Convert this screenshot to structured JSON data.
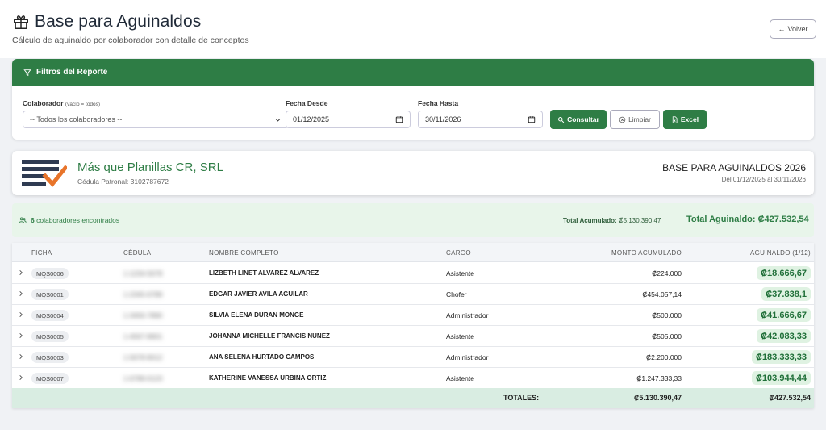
{
  "header": {
    "title": "Base para Aguinaldos",
    "subtitle": "Cálculo de aguinaldo por colaborador con detalle de conceptos",
    "back_label": "Volver"
  },
  "filters": {
    "heading": "Filtros del Reporte",
    "colaborador_label": "Colaborador",
    "colaborador_hint": "(vacío = todos)",
    "colaborador_value": "-- Todos los colaboradores --",
    "fecha_desde_label": "Fecha Desde",
    "fecha_desde_value": "01/12/2025",
    "fecha_hasta_label": "Fecha Hasta",
    "fecha_hasta_value": "30/11/2026",
    "consultar_label": "Consultar",
    "limpiar_label": "Limpiar",
    "excel_label": "Excel"
  },
  "company": {
    "name": "Más que Planillas CR, SRL",
    "cedula": "Cédula Patronal: 3102787672",
    "report_title": "BASE PARA AGUINALDOS 2026",
    "report_range": "Del 01/12/2025 al 30/11/2026"
  },
  "summary": {
    "count": "6",
    "count_text": "colaboradores encontrados",
    "total_acumulado_label": "Total Acumulado:",
    "total_acumulado_value": "₡5.130.390,47",
    "total_aguinaldo_label": "Total Aguinaldo:",
    "total_aguinaldo_value": "₡427.532,54"
  },
  "table": {
    "headers": {
      "ficha": "FICHA",
      "cedula": "CÉDULA",
      "nombre": "NOMBRE COMPLETO",
      "cargo": "CARGO",
      "monto": "MONTO ACUMULADO",
      "aguinaldo": "AGUINALDO (1/12)"
    },
    "rows": [
      {
        "ficha": "MQS0006",
        "cedula": "1-1234-5678",
        "nombre": "LIZBETH LINET ALVAREZ ALVAREZ",
        "cargo": "Asistente",
        "monto": "₡224.000",
        "aguinaldo": "₡18.666,67"
      },
      {
        "ficha": "MQS0001",
        "cedula": "1-2345-6789",
        "nombre": "EDGAR JAVIER AVILA AGUILAR",
        "cargo": "Chofer",
        "monto": "₡454.057,14",
        "aguinaldo": "₡37.838,1"
      },
      {
        "ficha": "MQS0004",
        "cedula": "1-3456-7890",
        "nombre": "SILVIA ELENA DURAN MONGE",
        "cargo": "Administrador",
        "monto": "₡500.000",
        "aguinaldo": "₡41.666,67"
      },
      {
        "ficha": "MQS0005",
        "cedula": "1-4567-8901",
        "nombre": "JOHANNA MICHELLE FRANCIS NUNEZ",
        "cargo": "Asistente",
        "monto": "₡505.000",
        "aguinaldo": "₡42.083,33"
      },
      {
        "ficha": "MQS0003",
        "cedula": "1-5678-9012",
        "nombre": "ANA SELENA HURTADO CAMPOS",
        "cargo": "Administrador",
        "monto": "₡2.200.000",
        "aguinaldo": "₡183.333,33"
      },
      {
        "ficha": "MQS0007",
        "cedula": "1-6789-0123",
        "nombre": "KATHERINE VANESSA URBINA ORTIZ",
        "cargo": "Asistente",
        "monto": "₡1.247.333,33",
        "aguinaldo": "₡103.944,44"
      }
    ],
    "totals_label": "TOTALES:",
    "totals_monto": "₡5.130.390,47",
    "totals_aguinaldo": "₡427.532,54"
  },
  "icons": {
    "title_icon": "gift-icon",
    "back_icon": "arrow-left-icon",
    "filter_icon": "filter-icon",
    "select_icon": "chevron-down-icon",
    "date_icon": "calendar-icon",
    "consultar_icon": "search-icon",
    "limpiar_icon": "clear-icon",
    "excel_icon": "file-excel-icon",
    "count_icon": "users-icon",
    "row_icon": "chevron-right-icon"
  },
  "colors": {
    "brand_green": "#2e7d45",
    "summary_bg": "#e8f5ea",
    "pill_bg": "#dff2e2",
    "totals_bg": "#d9ede2"
  }
}
